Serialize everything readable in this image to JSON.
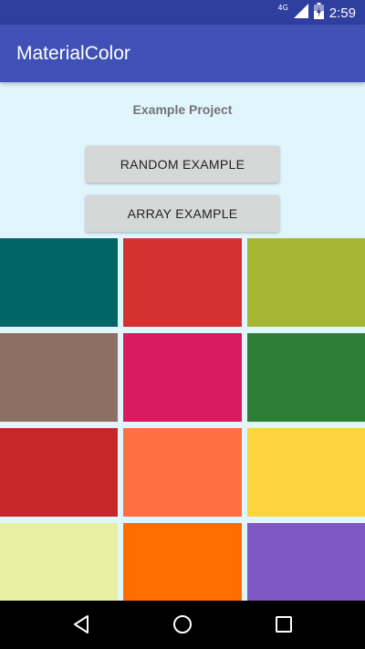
{
  "status_bar": {
    "network_label": "4G",
    "time": "2:59",
    "icons": [
      "signal-icon",
      "battery-icon"
    ]
  },
  "app_bar": {
    "title": "MaterialColor"
  },
  "main": {
    "subtitle": "Example Project",
    "random_button_label": "RANDOM EXAMPLE",
    "array_button_label": "ARRAY EXAMPLE"
  },
  "swatches": [
    {
      "color": "#006566"
    },
    {
      "color": "#d43230"
    },
    {
      "color": "#a5b633"
    },
    {
      "color": "#8d6f63"
    },
    {
      "color": "#d91b5f"
    },
    {
      "color": "#2f7e36"
    },
    {
      "color": "#c62829"
    },
    {
      "color": "#ff6f42"
    },
    {
      "color": "#fed43e"
    },
    {
      "color": "#e7f0a0"
    },
    {
      "color": "#ff6d00"
    },
    {
      "color": "#7f57c2"
    }
  ],
  "nav_bar": {
    "icons": [
      "back-icon",
      "home-icon",
      "recents-icon"
    ]
  }
}
